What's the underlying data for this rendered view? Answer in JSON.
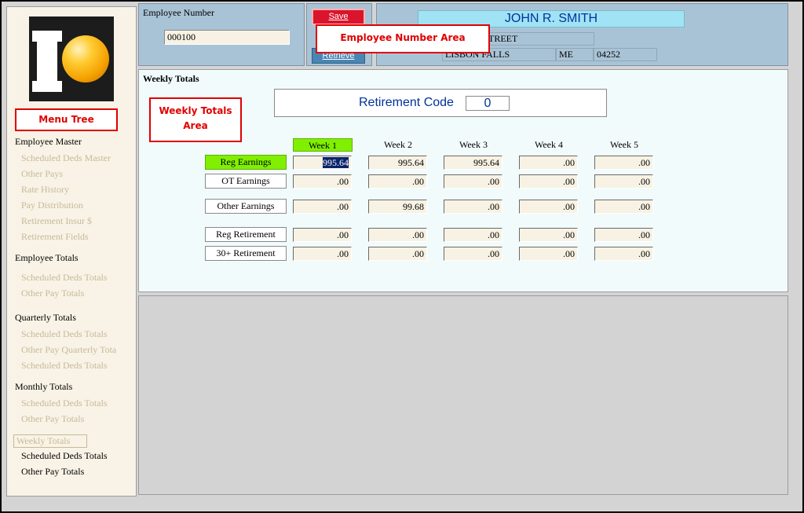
{
  "sidebar": {
    "callout": "Menu Tree",
    "items": [
      {
        "label": "Employee Master",
        "kind": "head"
      },
      {
        "label": "Scheduled Deds Master",
        "kind": "sub"
      },
      {
        "label": "Other Pays",
        "kind": "sub"
      },
      {
        "label": "Rate History",
        "kind": "sub"
      },
      {
        "label": "Pay Distribution",
        "kind": "sub"
      },
      {
        "label": "Retirement Insur $",
        "kind": "sub"
      },
      {
        "label": "Retirement Fields",
        "kind": "sub"
      },
      {
        "label": "Employee Totals",
        "kind": "head"
      },
      {
        "label": "Scheduled Deds Totals",
        "kind": "sub"
      },
      {
        "label": "Other Pay Totals",
        "kind": "sub"
      },
      {
        "label": "Quarterly Totals",
        "kind": "head"
      },
      {
        "label": "Scheduled Deds Totals",
        "kind": "sub"
      },
      {
        "label": "Other Pay Quarterly Tota",
        "kind": "sub"
      },
      {
        "label": "Scheduled Deds Totals",
        "kind": "sub"
      },
      {
        "label": "Monthly Totals",
        "kind": "head"
      },
      {
        "label": "Scheduled Deds Totals",
        "kind": "sub"
      },
      {
        "label": "Other Pay Totals",
        "kind": "sub"
      },
      {
        "label": "Weekly Totals",
        "kind": "selected"
      },
      {
        "label": "Scheduled Deds Totals",
        "kind": "sub2"
      },
      {
        "label": "Other Pay Totals",
        "kind": "sub2"
      }
    ]
  },
  "employee": {
    "label": "Employee Number",
    "value": "000100",
    "save_label": "Save",
    "retrieve_label": "Retrieve",
    "callout": "Employee Number Area",
    "name": "JOHN R. SMITH",
    "street": "TREET",
    "city": "LISBON FALLS",
    "state": "ME",
    "zip": "04252"
  },
  "weekly": {
    "title": "Weekly Totals",
    "callout_line1": "Weekly Totals",
    "callout_line2": "Area",
    "retirement_code_label": "Retirement Code",
    "retirement_code_value": "0",
    "weeks": [
      "Week 1",
      "Week 2",
      "Week 3",
      "Week 4",
      "Week 5"
    ],
    "rows": [
      {
        "label": "Reg Earnings",
        "values": [
          "995.64",
          "995.64",
          "995.64",
          ".00",
          ".00"
        ]
      },
      {
        "label": "OT Earnings",
        "values": [
          ".00",
          ".00",
          ".00",
          ".00",
          ".00"
        ]
      },
      {
        "label": "Other Earnings",
        "values": [
          ".00",
          "99.68",
          ".00",
          ".00",
          ".00"
        ]
      },
      {
        "label": "Reg Retirement",
        "values": [
          ".00",
          ".00",
          ".00",
          ".00",
          ".00"
        ]
      },
      {
        "label": "30+  Retirement",
        "values": [
          ".00",
          ".00",
          ".00",
          ".00",
          ".00"
        ]
      }
    ]
  },
  "colors": {
    "accent_green": "#80f000",
    "title_blue": "#003399",
    "callout_red": "#e00000"
  }
}
